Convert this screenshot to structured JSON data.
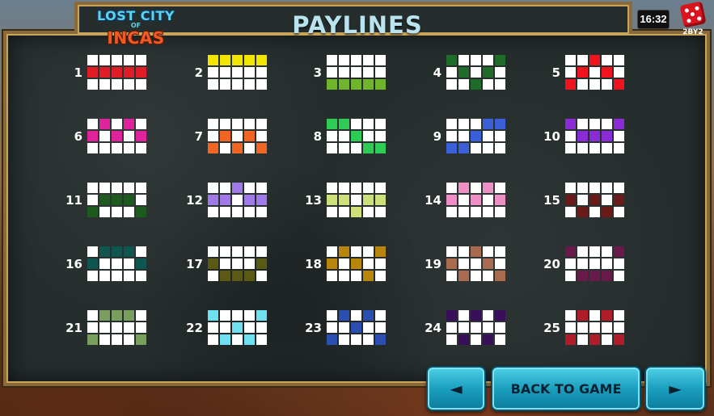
{
  "header": {
    "logo_line1": "LOST CITY",
    "logo_line2": "OF",
    "logo_line3": "INCAS",
    "title": "PAYLINES",
    "clock": "16:32",
    "brand": "2BY2"
  },
  "buttons": {
    "prev_label": "◄",
    "back_label": "BACK TO GAME",
    "next_label": "►"
  },
  "colors": {
    "board_bg": "#262d2d",
    "frame": "#8a6a3a",
    "title": "#b9e3ee",
    "button": "#1a9fbf"
  },
  "paylines": [
    {
      "number": "1",
      "color": "#e01c24",
      "pattern": [
        1,
        1,
        1,
        1,
        1
      ]
    },
    {
      "number": "2",
      "color": "#f2e500",
      "pattern": [
        0,
        0,
        0,
        0,
        0
      ]
    },
    {
      "number": "3",
      "color": "#6fb52c",
      "pattern": [
        2,
        2,
        2,
        2,
        2
      ]
    },
    {
      "number": "4",
      "color": "#1f6b2a",
      "pattern": [
        0,
        1,
        2,
        1,
        0
      ]
    },
    {
      "number": "5",
      "color": "#f0141e",
      "pattern": [
        2,
        1,
        0,
        1,
        2
      ]
    },
    {
      "number": "6",
      "color": "#e0239a",
      "pattern": [
        1,
        0,
        1,
        0,
        1
      ]
    },
    {
      "number": "7",
      "color": "#f26522",
      "pattern": [
        2,
        1,
        2,
        1,
        2
      ]
    },
    {
      "number": "8",
      "color": "#2ecc55",
      "pattern": [
        0,
        0,
        1,
        2,
        2
      ]
    },
    {
      "number": "9",
      "color": "#3a5fd9",
      "pattern": [
        2,
        2,
        1,
        0,
        0
      ]
    },
    {
      "number": "10",
      "color": "#8a2bd6",
      "pattern": [
        0,
        1,
        1,
        1,
        0
      ]
    },
    {
      "number": "11",
      "color": "#1d5a1d",
      "pattern": [
        2,
        1,
        1,
        1,
        2
      ]
    },
    {
      "number": "12",
      "color": "#9f7ae8",
      "pattern": [
        1,
        1,
        0,
        1,
        1
      ]
    },
    {
      "number": "13",
      "color": "#cfe07a",
      "pattern": [
        1,
        1,
        2,
        1,
        1
      ]
    },
    {
      "number": "14",
      "color": "#f08fc6",
      "pattern": [
        1,
        0,
        1,
        0,
        1
      ]
    },
    {
      "number": "15",
      "color": "#6b1a1a",
      "pattern": [
        1,
        2,
        1,
        2,
        1
      ]
    },
    {
      "number": "16",
      "color": "#0f5550",
      "pattern": [
        1,
        0,
        0,
        0,
        1
      ]
    },
    {
      "number": "17",
      "color": "#5a5a14",
      "pattern": [
        1,
        2,
        2,
        2,
        1
      ]
    },
    {
      "number": "18",
      "color": "#b8860b",
      "pattern": [
        1,
        0,
        1,
        2,
        0
      ]
    },
    {
      "number": "19",
      "color": "#a86b4f",
      "pattern": [
        1,
        2,
        0,
        1,
        2
      ]
    },
    {
      "number": "20",
      "color": "#6a1a4a",
      "pattern": [
        0,
        2,
        2,
        2,
        0
      ]
    },
    {
      "number": "21",
      "color": "#7a9e5e",
      "pattern": [
        2,
        0,
        0,
        0,
        2
      ]
    },
    {
      "number": "22",
      "color": "#6fe0f0",
      "pattern": [
        0,
        2,
        1,
        2,
        0
      ]
    },
    {
      "number": "23",
      "color": "#2a4fb0",
      "pattern": [
        2,
        0,
        1,
        0,
        2
      ]
    },
    {
      "number": "24",
      "color": "#3a0f5a",
      "pattern": [
        0,
        2,
        0,
        2,
        0
      ]
    },
    {
      "number": "25",
      "color": "#b01c2a",
      "pattern": [
        2,
        0,
        2,
        0,
        2
      ]
    }
  ]
}
